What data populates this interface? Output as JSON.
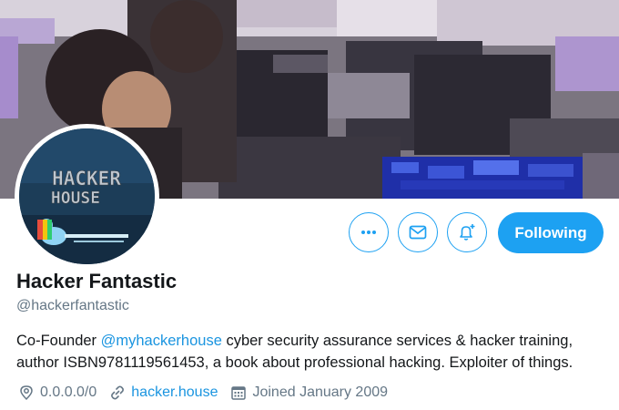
{
  "profile": {
    "display_name": "Hacker Fantastic",
    "handle": "@hackerfantastic",
    "bio": {
      "before_mention": "Co-Founder ",
      "mention": "@myhackerhouse",
      "after_mention": " cyber security assurance services & hacker training, author ISBN9781119561453, a book about professional hacking. Exploiter of things."
    },
    "location": "0.0.0.0/0",
    "website": "hacker.house",
    "joined": "Joined January 2009",
    "avatar_text": [
      "HACKER",
      "HOUSE"
    ]
  },
  "actions": {
    "follow_label": "Following"
  },
  "icons": {
    "more": "more-dots-icon",
    "message": "envelope-icon",
    "notify": "bell-plus-icon",
    "location": "location-pin-icon",
    "link": "link-icon",
    "calendar": "calendar-icon"
  },
  "colors": {
    "accent": "#1da1f2",
    "link": "#1b95e0",
    "secondary_text": "#657786",
    "primary_text": "#14171a"
  }
}
